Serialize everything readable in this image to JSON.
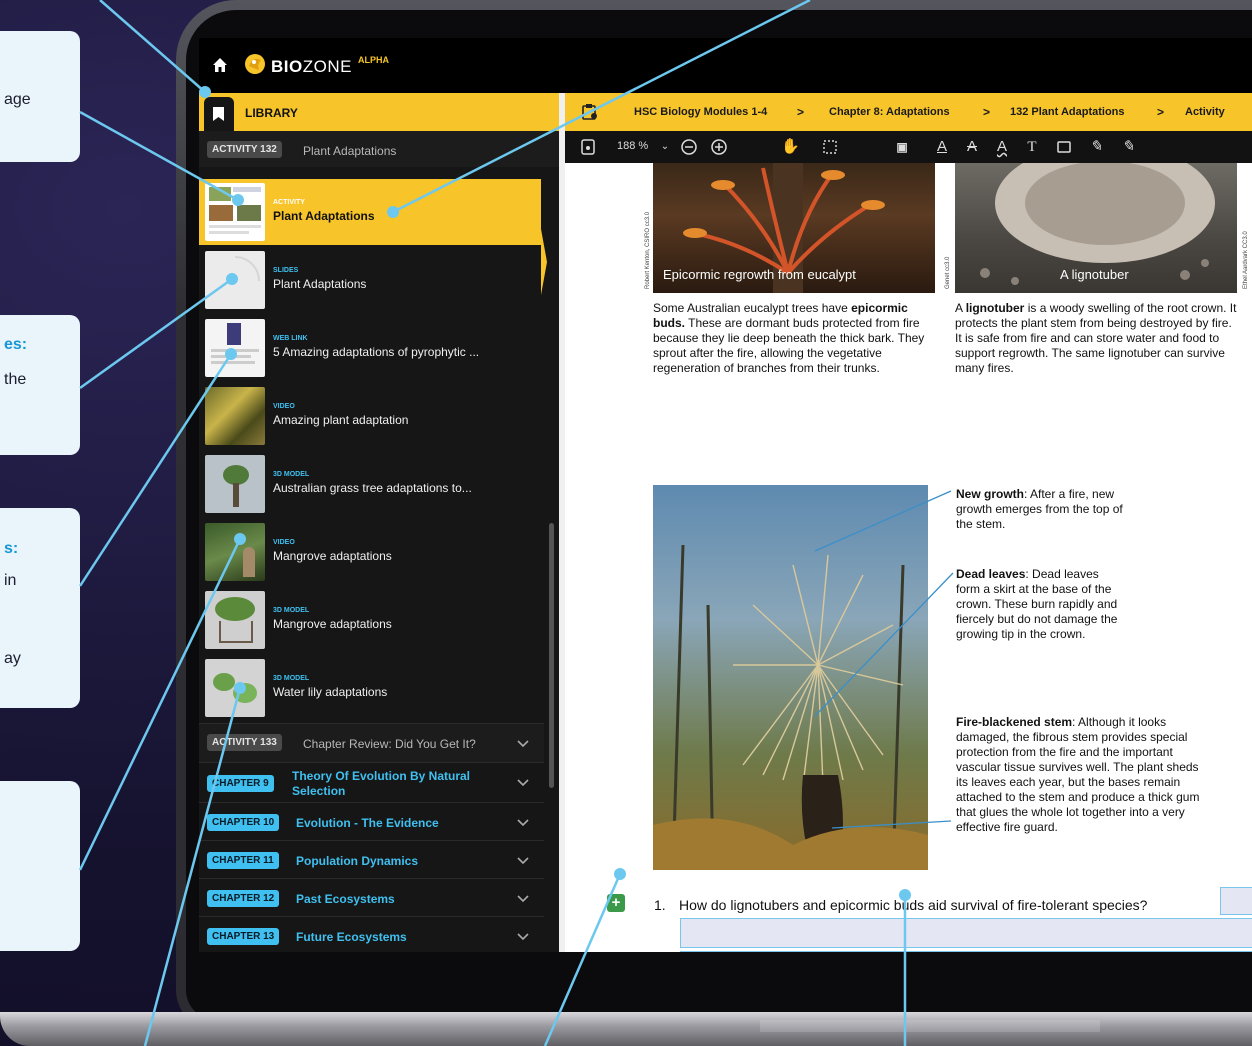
{
  "colors": {
    "accent": "#f7c42a",
    "link_blue": "#3fc0f0",
    "callout_line": "#6cc8ef"
  },
  "callouts": [
    {
      "title": "",
      "body": "age"
    },
    {
      "title": "es:",
      "body": "the"
    },
    {
      "title": "s:",
      "body_lines": [
        "in",
        "ay"
      ]
    },
    {
      "title": "",
      "body": ""
    }
  ],
  "app": {
    "home_icon": "home-icon",
    "logo": {
      "bold": "BIO",
      "thin": "ZONE",
      "sup": "ALPHA"
    }
  },
  "sidebar": {
    "library_label": "LIBRARY",
    "activity_badge": "ACTIVITY 132",
    "activity_title": "Plant Adaptations",
    "items": [
      {
        "type": "ACTIVITY",
        "label": "Plant Adaptations",
        "active": true
      },
      {
        "type": "SLIDES",
        "label": "Plant Adaptations"
      },
      {
        "type": "WEB LINK",
        "label": "5 Amazing adaptations of pyrophytic ..."
      },
      {
        "type": "VIDEO",
        "label": "Amazing plant adaptation"
      },
      {
        "type": "3D MODEL",
        "label": "Australian grass tree adaptations to..."
      },
      {
        "type": "VIDEO",
        "label": "Mangrove adaptations"
      },
      {
        "type": "3D MODEL",
        "label": "Mangrove adaptations"
      },
      {
        "type": "3D MODEL",
        "label": "Water lily adaptations"
      }
    ],
    "activity133": {
      "badge": "ACTIVITY 133",
      "title": "Chapter Review: Did You Get It?"
    },
    "chapters": [
      {
        "badge": "CHAPTER 9",
        "title_line1": "Theory Of Evolution By Natural",
        "title_line2": "Selection"
      },
      {
        "badge": "CHAPTER 10",
        "title_line1": "Evolution - The Evidence"
      },
      {
        "badge": "CHAPTER 11",
        "title_line1": "Population Dynamics"
      },
      {
        "badge": "CHAPTER 12",
        "title_line1": "Past Ecosystems"
      },
      {
        "badge": "CHAPTER 13",
        "title_line1": "Future Ecosystems"
      }
    ]
  },
  "viewer": {
    "breadcrumbs": [
      "HSC Biology Modules 1-4",
      "Chapter 8: Adaptations",
      "132 Plant Adaptations",
      "Activity"
    ],
    "zoom": "188 %",
    "doc": {
      "photo1_caption": "Epicormic regrowth from eucalypt",
      "photo2_caption": "A lignotuber",
      "credit1": "Robert Kenton, CSIRO cc3.0",
      "credit2": "Genet cc3.0",
      "credit3": "Ethel Aardvark CC3.0",
      "para_epicormic": {
        "pre": "Some Australian eucalypt trees have ",
        "bold": "epicormic buds.",
        "post": " These are dormant buds protected from fire because they lie deep beneath the thick bark. They sprout after the fire, allowing the vegetative regeneration of branches from their trunks."
      },
      "para_lignotuber": {
        "pre": "A ",
        "bold": "lignotuber",
        "post": " is a woody swelling of the root crown. It protects the plant stem from being destroyed by fire. It is safe from fire and can store water and food to support regrowth. The same lignotuber can survive many fires."
      },
      "new_growth": {
        "bold": "New growth",
        "text": ": After a fire, new growth emerges from the top of the stem."
      },
      "dead_leaves": {
        "bold": "Dead leaves",
        "text": ": Dead leaves form a skirt at the base of the crown. These burn rapidly and fiercely but do not damage the growing tip in the crown."
      },
      "fire_stem": {
        "bold": "Fire-blackened stem",
        "text": ": Although it looks damaged, the fibrous stem provides special protection from the fire and the important vascular tissue survives well. The plant sheds its leaves each year, but the bases remain attached to the stem and produce a thick gum that glues the whole lot together into a very effective fire guard."
      },
      "question_number": "1.",
      "question_text": "How do lignotubers and epicormic buds aid survival of fire-tolerant species?"
    }
  }
}
